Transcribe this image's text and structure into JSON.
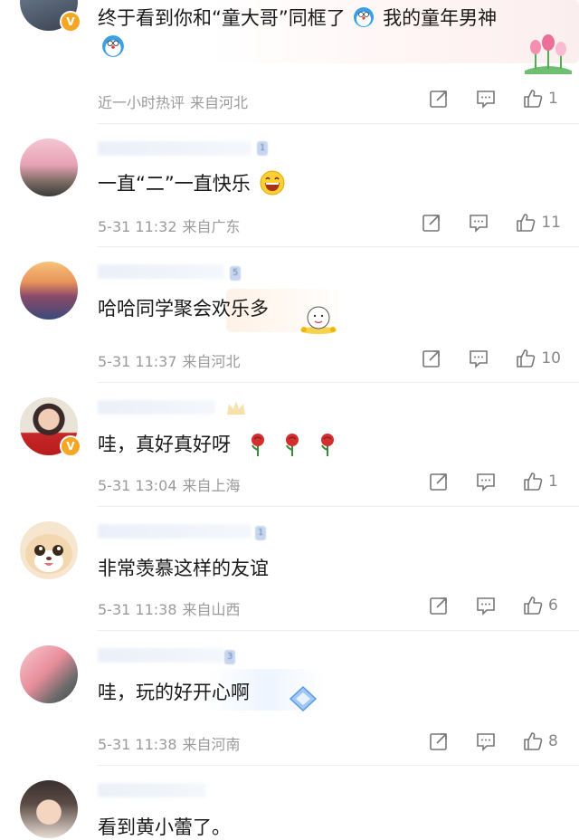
{
  "comments": [
    {
      "text": "终于看到你和“童大哥”同框了",
      "text2": "我的童年男神",
      "time": "近一小时热评",
      "location": "来自河北",
      "likes": "1",
      "verified": true
    },
    {
      "text": "一直“二”一直快乐",
      "fan_badge": "1",
      "time": "5-31 11:32",
      "location": "来自广东",
      "likes": "11"
    },
    {
      "text": "哈哈同学聚会欢乐多",
      "fan_badge": "5",
      "time": "5-31 11:37",
      "location": "来自河北",
      "likes": "10"
    },
    {
      "text": "哇，真好真好呀",
      "time": "5-31 13:04",
      "location": "来自上海",
      "likes": "1",
      "verified": true
    },
    {
      "text": "非常羡慕这样的友谊",
      "fan_badge": "1",
      "time": "5-31 11:38",
      "location": "来自山西",
      "likes": "6"
    },
    {
      "text": "哇，玩的好开心啊",
      "fan_badge": "3",
      "time": "5-31 11:38",
      "location": "来自河南",
      "likes": "8"
    },
    {
      "text": "看到黄小蕾了。"
    }
  ],
  "icons": {
    "share": "share-icon",
    "comment": "comment-icon",
    "like": "thumbs-up-icon"
  },
  "colors": {
    "meta_gray": "#9a9a9a",
    "verified_badge": "#f5a623",
    "divider": "#eeeeee"
  }
}
